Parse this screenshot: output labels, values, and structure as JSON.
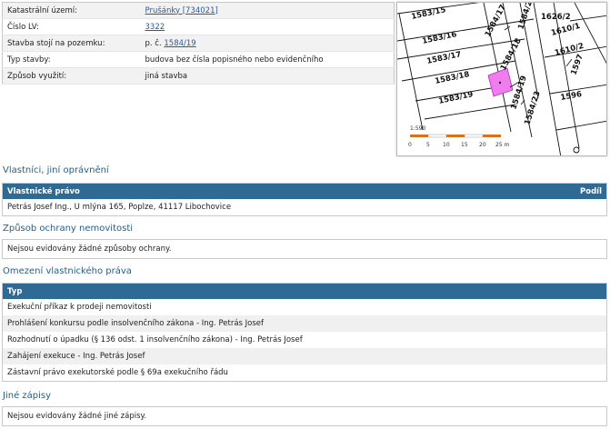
{
  "info": [
    {
      "label": "Katastrální území:",
      "value": "Prušánky [734021]",
      "link": true
    },
    {
      "label": "Číslo LV:",
      "value": "3322",
      "link": true
    },
    {
      "label": "Stavba stojí na pozemku:",
      "prefix": "p. č.",
      "value": "1584/19",
      "link": true
    },
    {
      "label": "Typ stavby:",
      "value": "budova bez čísla popisného nebo evidenčního",
      "link": false
    },
    {
      "label": "Způsob využití:",
      "value": "jiná stavba",
      "link": false
    }
  ],
  "map": {
    "parcels": [
      "1583/15",
      "1583/16",
      "1583/17",
      "1583/18",
      "1583/19",
      "1584/17",
      "1584/18",
      "1584/19",
      "1584/23",
      "1584/22",
      "1626/2",
      "1610/1",
      "1610/2",
      "1597",
      "1596"
    ],
    "scale_label": "1:590",
    "scale_ticks": [
      "0",
      "5",
      "10",
      "15",
      "20",
      "25 m"
    ],
    "highlight_color": "#f07cf0"
  },
  "owners": {
    "title": "Vlastníci, jiní oprávnění",
    "col_left": "Vlastnické právo",
    "col_right": "Podíl",
    "rows": [
      "Petrás Josef Ing., U mlýna 165, Poplze, 41117 Libochovice"
    ]
  },
  "protection": {
    "title": "Způsob ochrany nemovitosti",
    "message": "Nejsou evidovány žádné způsoby ochrany."
  },
  "restrictions": {
    "title": "Omezení vlastnického práva",
    "col": "Typ",
    "rows": [
      "Exekuční příkaz k prodeji nemovitosti",
      "Prohlášení konkursu podle insolvenčního zákona - Ing. Petrás Josef",
      "Rozhodnutí o úpadku (§ 136 odst. 1 insolvenčního zákona) - Ing. Petrás Josef",
      "Zahájení exekuce - Ing. Petrás Josef",
      "Zástavní právo exekutorské podle § 69a exekučního řádu"
    ]
  },
  "other": {
    "title": "Jiné zápisy",
    "message": "Nejsou evidovány žádné jiné zápisy."
  },
  "colors": {
    "header": "#2e6a94",
    "title": "#1f5f8b",
    "link": "#2a5c9a"
  }
}
